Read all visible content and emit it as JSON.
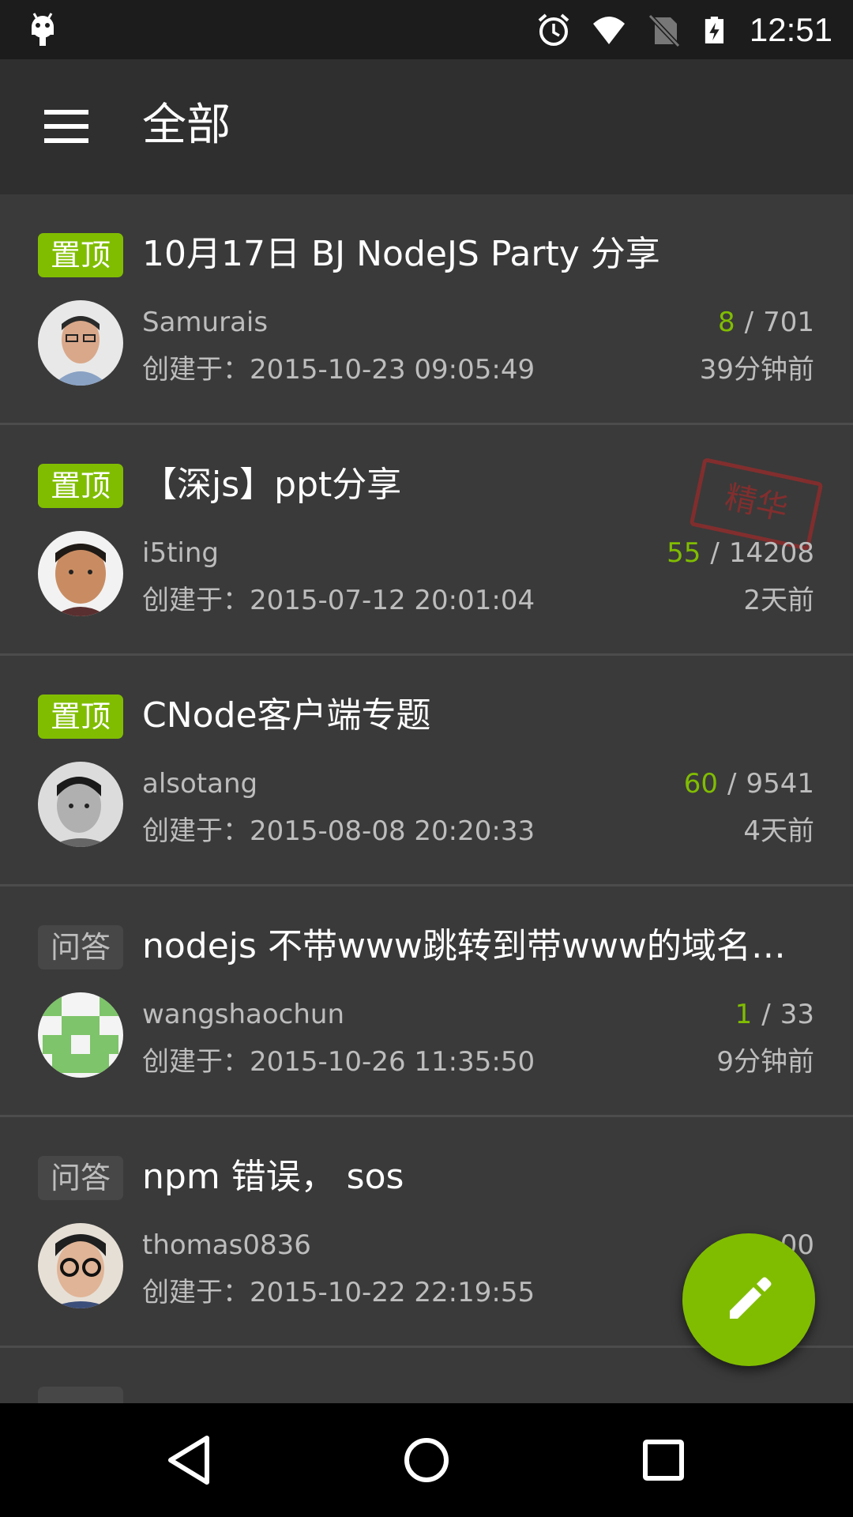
{
  "status_bar": {
    "time": "12:51",
    "icons": [
      "android-icon",
      "alarm-icon",
      "wifi-icon",
      "no-sim-icon",
      "battery-charging-icon"
    ]
  },
  "app_bar": {
    "title": "全部",
    "menu_icon": "menu-icon"
  },
  "topics": [
    {
      "tag": "置顶",
      "tag_type": "top",
      "title": "10月17日 BJ NodeJS Party 分享",
      "author": "Samurais",
      "created": "创建于：2015-10-23 09:05:49",
      "reply_count": "8",
      "visit_count": "701",
      "last_reply": "39分钟前"
    },
    {
      "tag": "置顶",
      "tag_type": "top",
      "title": "【深js】ppt分享",
      "author": "i5ting",
      "created": "创建于：2015-07-12 20:01:04",
      "reply_count": "55",
      "visit_count": "14208",
      "last_reply": "2天前",
      "badge": "精华"
    },
    {
      "tag": "置顶",
      "tag_type": "top",
      "title": "CNode客户端专题",
      "author": "alsotang",
      "created": "创建于：2015-08-08 20:20:33",
      "reply_count": "60",
      "visit_count": "9541",
      "last_reply": "4天前"
    },
    {
      "tag": "问答",
      "tag_type": "ask",
      "title": "nodejs 不带www跳转到带www的域名…",
      "author": "wangshaochun",
      "created": "创建于：2015-10-26 11:35:50",
      "reply_count": "1",
      "visit_count": "33",
      "last_reply": "9分钟前"
    },
    {
      "tag": "问答",
      "tag_type": "ask",
      "title": "npm 错误， sos",
      "author": "thomas0836",
      "created": "创建于：2015-10-22 22:19:55",
      "visit_count_partial": "00"
    }
  ],
  "separator": "/",
  "fab": {
    "icon": "pencil-icon"
  },
  "nav_bar": {
    "icons": [
      "back-icon",
      "home-icon",
      "recents-icon"
    ]
  },
  "colors": {
    "accent": "#80bd01",
    "background": "#3a3a3a",
    "app_bar": "#2f2f2f",
    "status_bar": "#1c1c1c"
  }
}
